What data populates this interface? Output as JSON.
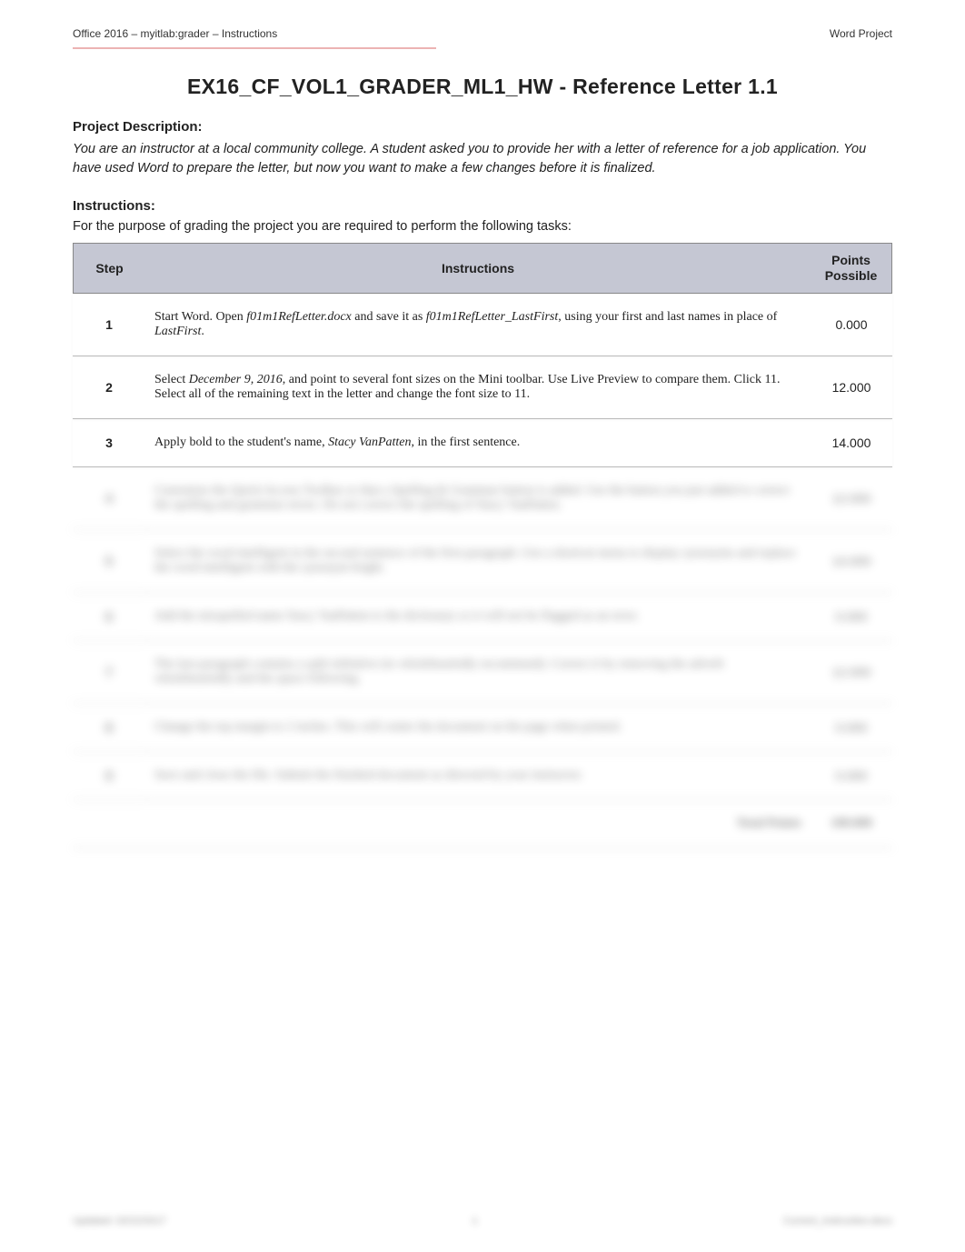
{
  "header": {
    "left": "Office 2016 – myitlab:grader – Instructions",
    "right": "Word Project"
  },
  "title": "EX16_CF_VOL1_GRADER_ML1_HW - Reference Letter 1.1",
  "project_label": "Project Description:",
  "project_desc": "You are an instructor at a local community college. A student asked you to provide her with a letter of reference for a job application. You have used Word to prepare the letter, but now you want to make a few changes before it is finalized.",
  "instructions_label": "Instructions:",
  "instructions_intro": "For the purpose of grading the project you are required to perform the following tasks:",
  "table": {
    "col_step": "Step",
    "col_instr": "Instructions",
    "col_points": "Points Possible"
  },
  "rows": [
    {
      "step": "1",
      "instr_html": "Start Word. Open <span class='ital'>f01m1RefLetter.docx</span> and save it as <span class='ital'>f01m1RefLetter_LastFirst</span>, using your first and last names in place of <span class='ital'>LastFirst</span>.",
      "points": "0.000"
    },
    {
      "step": "2",
      "instr_html": "Select <span class='ital'>December 9, 2016</span>, and point to several font sizes on the Mini toolbar. Use Live Preview to compare them. Click 11. Select all of the remaining text in the letter and change the font size to 11.",
      "points": "12.000"
    },
    {
      "step": "3",
      "instr_html": "Apply bold to the student's name, <span class='ital'>Stacy VanPatten</span>, in the first sentence.",
      "points": "14.000"
    },
    {
      "step": "4",
      "instr_html": "Customize the Quick Access Toolbar so that a Spelling & Grammar button is added. Use the button you just added to correct the spelling and grammar errors. Do not correct the spelling of Stacy VanPatten.",
      "points": "12.000",
      "blurred": true
    },
    {
      "step": "5",
      "instr_html": "Select the word intelligent in the second sentence of the first paragraph. Use a shortcut menu to display synonyms and replace the word intelligent with the synonym bright.",
      "points": "14.000",
      "blurred": true
    },
    {
      "step": "6",
      "instr_html": "Add the misspelled name Stacy VanPatten to the dictionary so it will not be flagged as an error.",
      "points": "0.000",
      "blurred": true
    },
    {
      "step": "7",
      "instr_html": "The last paragraph contains a split infinitive (to wholeheartedly recommend). Correct it by removing the adverb wholeheartedly and the space following.",
      "points": "12.000",
      "blurred": true
    },
    {
      "step": "8",
      "instr_html": "Change the top margin to 2 inches. This will center the document on the page when printed.",
      "points": "0.000",
      "blurred": true
    },
    {
      "step": "9",
      "instr_html": "Save and close the file. Submit the finished document as directed by your instructor.",
      "points": "0.000",
      "blurred": true
    }
  ],
  "total": {
    "label": "Total Points",
    "value": "100.000"
  },
  "footer": {
    "left": "Updated: 02/22/2017",
    "center": "1",
    "right": "Current_Instruction.docx"
  }
}
